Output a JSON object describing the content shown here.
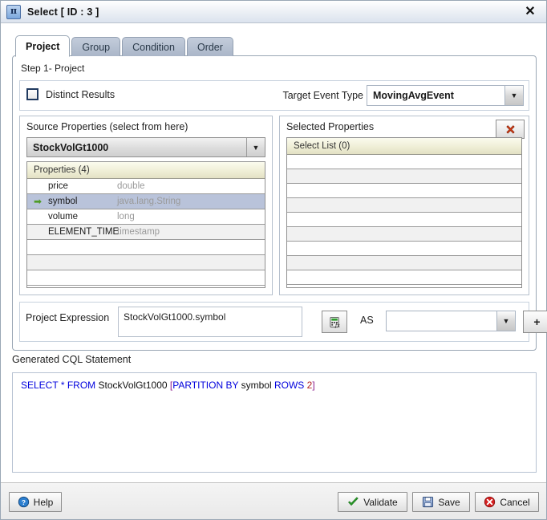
{
  "window": {
    "title": "Select [ ID : 3 ]",
    "icon": "pi-icon",
    "icon_glyph": "π",
    "close_label": "✕"
  },
  "tabs": [
    {
      "label": "Project",
      "active": true
    },
    {
      "label": "Group",
      "active": false
    },
    {
      "label": "Condition",
      "active": false
    },
    {
      "label": "Order",
      "active": false
    }
  ],
  "step": {
    "label": "Step 1- Project"
  },
  "distinct": {
    "label": "Distinct Results",
    "checked": false
  },
  "target_event_type": {
    "label": "Target Event Type",
    "value": "MovingAvgEvent",
    "arrow": "▼"
  },
  "source_properties": {
    "title": "Source Properties (select from here)",
    "stream": "StockVolGt1000",
    "arrow": "▼",
    "grid_header": "Properties (4)",
    "rows": [
      {
        "selected": false,
        "name": "price",
        "type": "double"
      },
      {
        "selected": true,
        "name": "symbol",
        "type": "java.lang.String"
      },
      {
        "selected": false,
        "name": "volume",
        "type": "long"
      },
      {
        "selected": false,
        "name": "ELEMENT_TIME",
        "type": "timestamp"
      },
      {
        "selected": false,
        "name": "",
        "type": ""
      },
      {
        "selected": false,
        "name": "",
        "type": ""
      },
      {
        "selected": false,
        "name": "",
        "type": ""
      }
    ],
    "selected_arrow": "➡"
  },
  "selected_properties": {
    "title": "Selected Properties",
    "delete_icon": "red-x-icon",
    "grid_header": "Select List (0)",
    "row_count": 9
  },
  "project_expression": {
    "label": "Project Expression",
    "value": "StockVolGt1000.symbol",
    "fx_icon": "expression-builder-icon",
    "as_label": "AS",
    "as_value": "",
    "as_arrow": "▼",
    "add_label": "+"
  },
  "cql": {
    "label": "Generated CQL Statement",
    "tokens": [
      {
        "text": "SELECT",
        "cls": "kw"
      },
      {
        "text": " ",
        "cls": "idn"
      },
      {
        "text": "*",
        "cls": "kw"
      },
      {
        "text": " ",
        "cls": "idn"
      },
      {
        "text": "FROM",
        "cls": "kw"
      },
      {
        "text": " StockVolGt1000  ",
        "cls": "idn"
      },
      {
        "text": "[",
        "cls": "br"
      },
      {
        "text": "PARTITION BY",
        "cls": "kw"
      },
      {
        "text": " symbol  ",
        "cls": "idn"
      },
      {
        "text": "ROWS",
        "cls": "kw"
      },
      {
        "text": " ",
        "cls": "idn"
      },
      {
        "text": "2",
        "cls": "num"
      },
      {
        "text": "]",
        "cls": "br"
      }
    ],
    "plain": "SELECT * FROM StockVolGt1000  [PARTITION BY symbol  ROWS 2]"
  },
  "footer": {
    "help": {
      "label": "Help",
      "icon": "help-icon"
    },
    "validate": {
      "label": "Validate",
      "icon": "check-icon"
    },
    "save": {
      "label": "Save",
      "icon": "floppy-icon"
    },
    "cancel": {
      "label": "Cancel",
      "icon": "cancel-icon"
    }
  },
  "colors": {
    "accent_blue": "#0000dd",
    "bracket": "#8b1a8b",
    "number": "#b02020",
    "selection": "#b9c3da",
    "grid_header": "#eeedd4",
    "green_arrow": "#4f9b27"
  }
}
